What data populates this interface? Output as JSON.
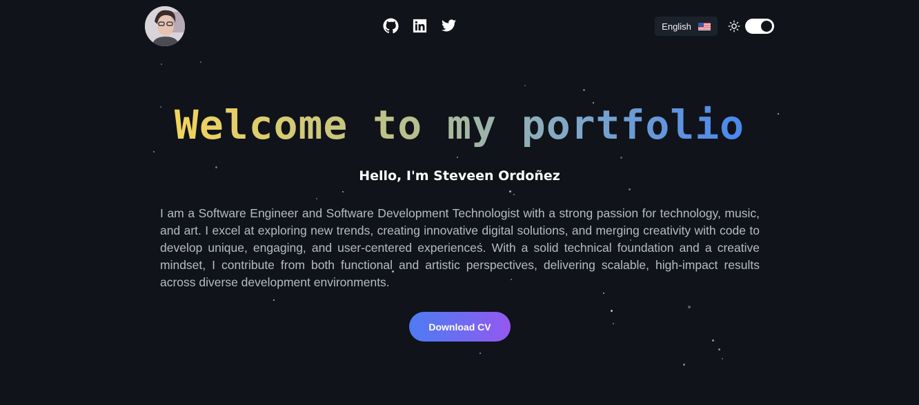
{
  "header": {
    "avatar_alt": "",
    "socials": [
      {
        "icon": "github-icon"
      },
      {
        "icon": "linkedin-icon"
      },
      {
        "icon": "twitter-icon"
      }
    ],
    "language": {
      "label": "English",
      "flag": "us-flag-icon"
    },
    "theme": {
      "icon": "sun-icon",
      "toggle_on": true
    }
  },
  "hero": {
    "title": "Welcome to my portfolio",
    "greeting": "Hello, I'm Steveen Ordoñez",
    "bio": "I am a Software Engineer and Software Development Technologist with a strong passion for technology, music, and art. I excel at exploring new trends, creating innovative digital solutions, and merging creativity with code to develop unique, engaging, and user-centered experiences. With a solid technical foundation and a creative mindset, I contribute from both functional and artistic perspectives, delivering scalable, high-impact results across diverse development environments.",
    "cta_label": "Download CV"
  },
  "colors": {
    "background": "#10131a",
    "title_gradient_start": "#f2d45c",
    "title_gradient_end": "#4a87ef",
    "button_gradient_start": "#4f7bf2",
    "button_gradient_end": "#9458ef",
    "bio_text": "#b6bbc6"
  }
}
